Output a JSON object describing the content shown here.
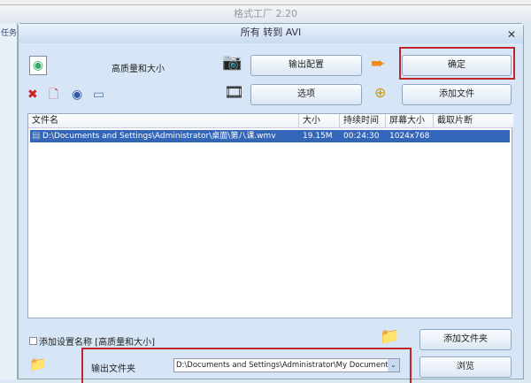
{
  "app": {
    "title": "格式工厂 2.20",
    "left_label": "任务"
  },
  "dialog": {
    "title": "所有 转到 AVI",
    "profile": "高质量和大小",
    "buttons": {
      "output_config": "输出配置",
      "ok": "确定",
      "options": "选项",
      "add_file": "添加文件",
      "add_folder": "添加文件夹",
      "browse": "浏览"
    },
    "columns": [
      "文件名",
      "大小",
      "持续时间",
      "屏幕大小",
      "截取片断"
    ],
    "files": [
      {
        "name": "D:\\Documents and Settings\\Administrator\\桌面\\第八课.wmv",
        "size": "19.15M",
        "duration": "00:24:30",
        "resolution": "1024x768",
        "clip": ""
      }
    ],
    "add_setting_name_label": "添加设置名称 [高质量和大小]",
    "output_folder_label": "输出文件夹",
    "output_folder_value": "D:\\Documents and Settings\\Administrator\\My Documents\\FFO",
    "highlight_color": "#c0252b",
    "selection_color": "#3366b8"
  }
}
